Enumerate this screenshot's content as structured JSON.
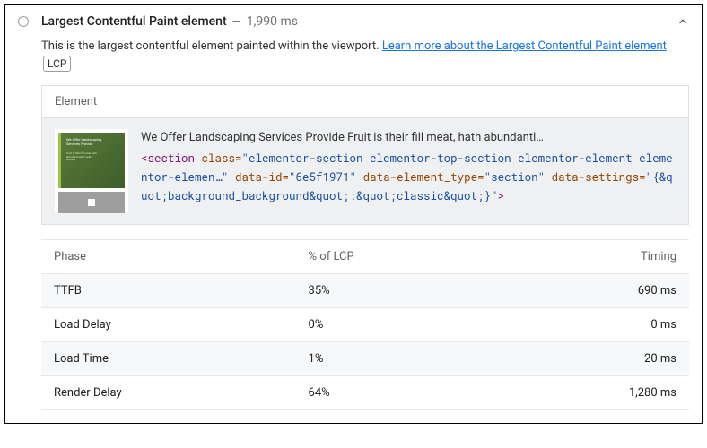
{
  "header": {
    "title": "Largest Contentful Paint element",
    "separator": "—",
    "timing": "1,990 ms"
  },
  "description": {
    "intro": "This is the largest contentful element painted within the viewport. ",
    "link_text": "Learn more about the Largest Contentful Paint element",
    "badge": "LCP"
  },
  "element_box": {
    "header": "Element",
    "title_line": "We Offer Landscaping Services Provide Fruit is their fill meat, hath abundantl…",
    "code_open": "<section ",
    "code_class_attr": "class=",
    "code_class_val": "\"elementor-section elementor-top-section elementor-element elementor-elemen…\"",
    "code_id_attr": " data-id=",
    "code_id_val": "\"6e5f1971\"",
    "code_type_attr": " data-element_type=",
    "code_type_val": "\"section\"",
    "code_settings_attr": " data-settings=",
    "code_settings_val": "\"{&quot;background_background&quot;:&quot;classic&quot;}\"",
    "code_close": ">"
  },
  "phase_table": {
    "headers": {
      "phase": "Phase",
      "pct": "% of LCP",
      "timing": "Timing"
    },
    "rows": [
      {
        "phase": "TTFB",
        "pct": "35%",
        "timing": "690 ms"
      },
      {
        "phase": "Load Delay",
        "pct": "0%",
        "timing": "0 ms"
      },
      {
        "phase": "Load Time",
        "pct": "1%",
        "timing": "20 ms"
      },
      {
        "phase": "Render Delay",
        "pct": "64%",
        "timing": "1,280 ms"
      }
    ]
  }
}
